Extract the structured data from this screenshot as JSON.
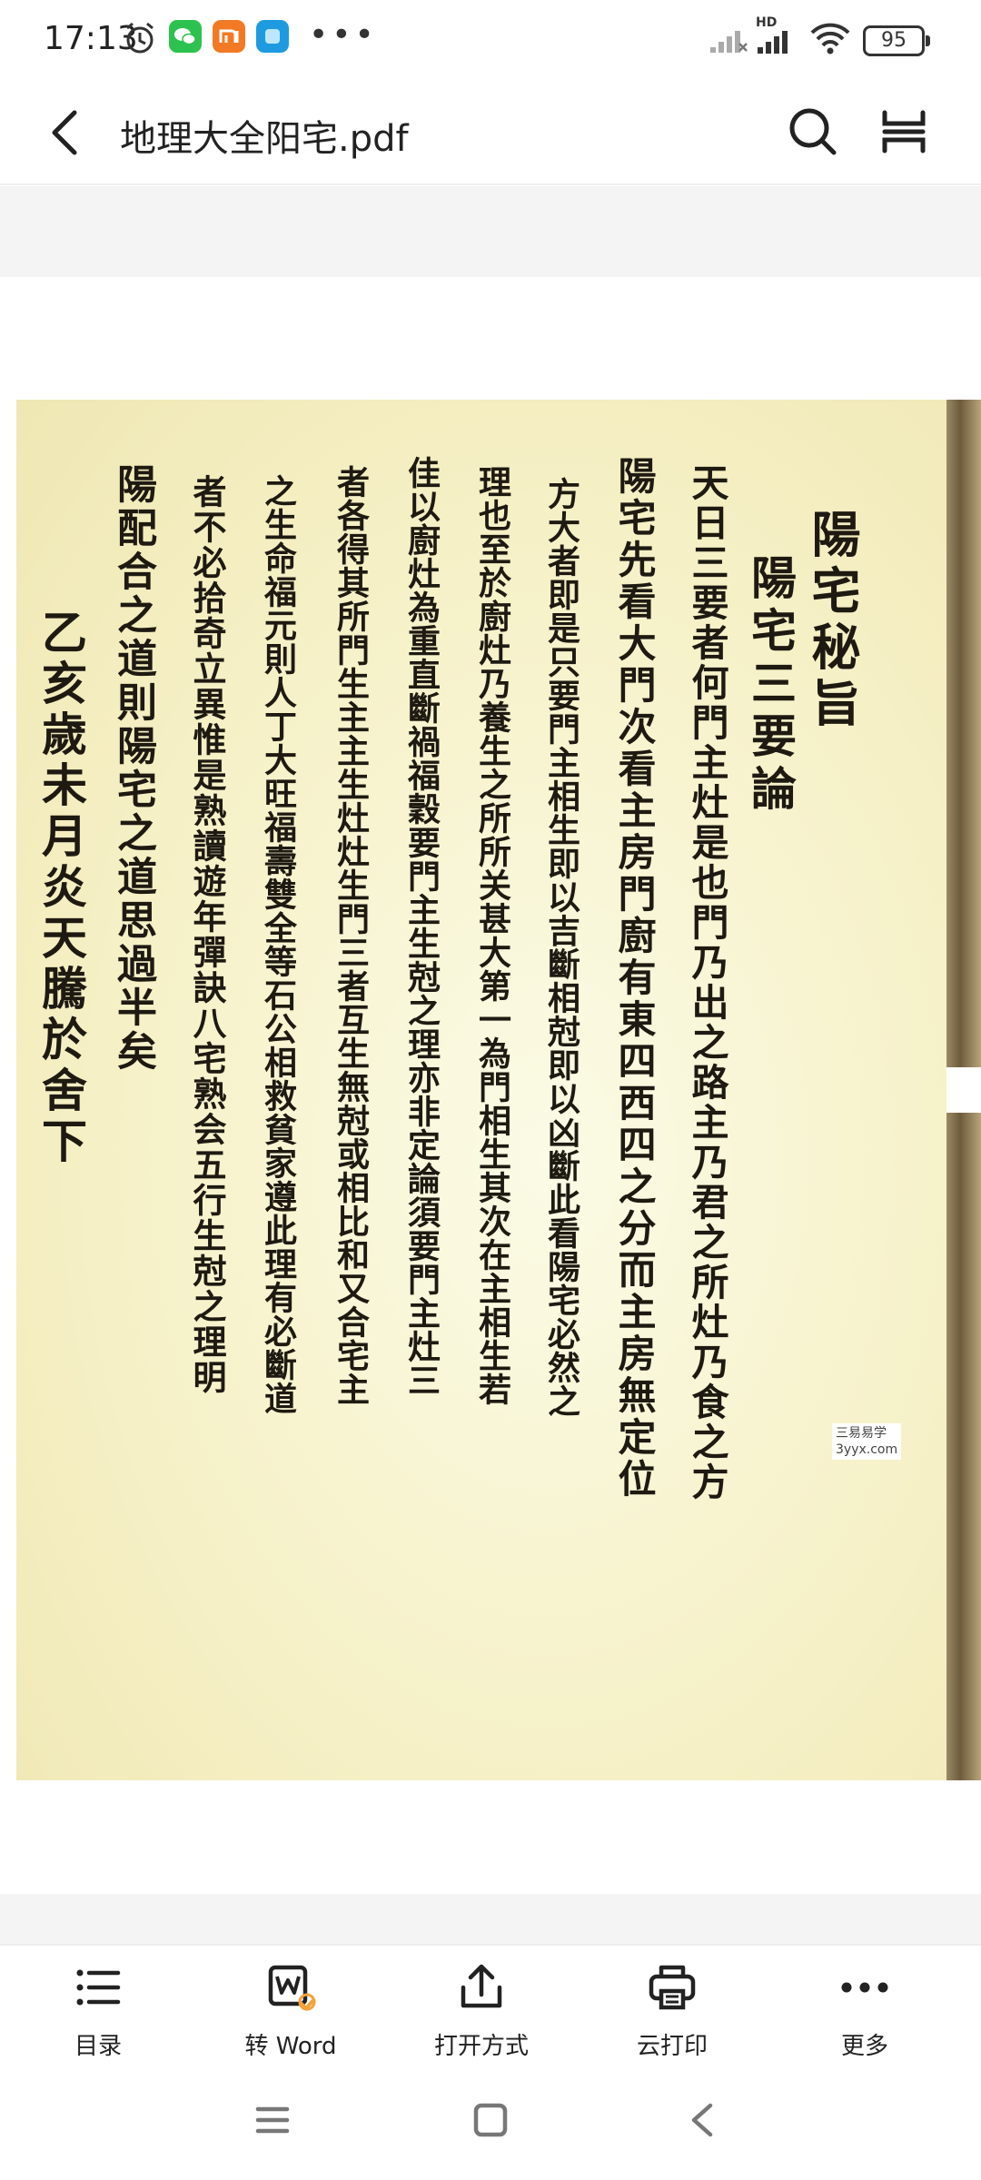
{
  "status_bar": {
    "time": "17:13",
    "battery": "95",
    "network": "HD"
  },
  "header": {
    "title": "地理大全阳宅.pdf"
  },
  "document": {
    "columns": [
      "陽宅秘旨",
      "陽宅三要論",
      "天日三要者何門主灶是也門乃出之路主乃君之所灶乃食之方",
      "陽宅先看大門次看主房門廚有東四西四之分而主房無定位",
      "方大者即是只要門主相生即以吉斷相尅即以凶斷此看陽宅必然之",
      "理也至於廚灶乃養生之所所关甚大第一為門相生其次在主相生若",
      "佳以廚灶為重直斷禍福穀要門主生尅之理亦非定論須要門主灶三",
      "者各得其所門生主主生灶灶生門三者互生無尅或相比和又合宅主",
      "之生命福元則人丁大旺福壽雙全等石公相救貧家遵此理有必斷道",
      "者不必拾奇立異惟是熟讀遊年彈訣八宅熟会五行生尅之理明",
      "陽配合之道則陽宅之道思過半矣",
      "乙亥歲未月炎天騰於舍下"
    ],
    "watermark_line1": "三易易学",
    "watermark_line2": "3yyx.com"
  },
  "toolbar": {
    "items": [
      {
        "label": "目录",
        "icon": "list-icon"
      },
      {
        "label": "转 Word",
        "icon": "convert-word-icon"
      },
      {
        "label": "打开方式",
        "icon": "share-icon"
      },
      {
        "label": "云打印",
        "icon": "printer-icon"
      },
      {
        "label": "更多",
        "icon": "more-icon"
      }
    ]
  }
}
